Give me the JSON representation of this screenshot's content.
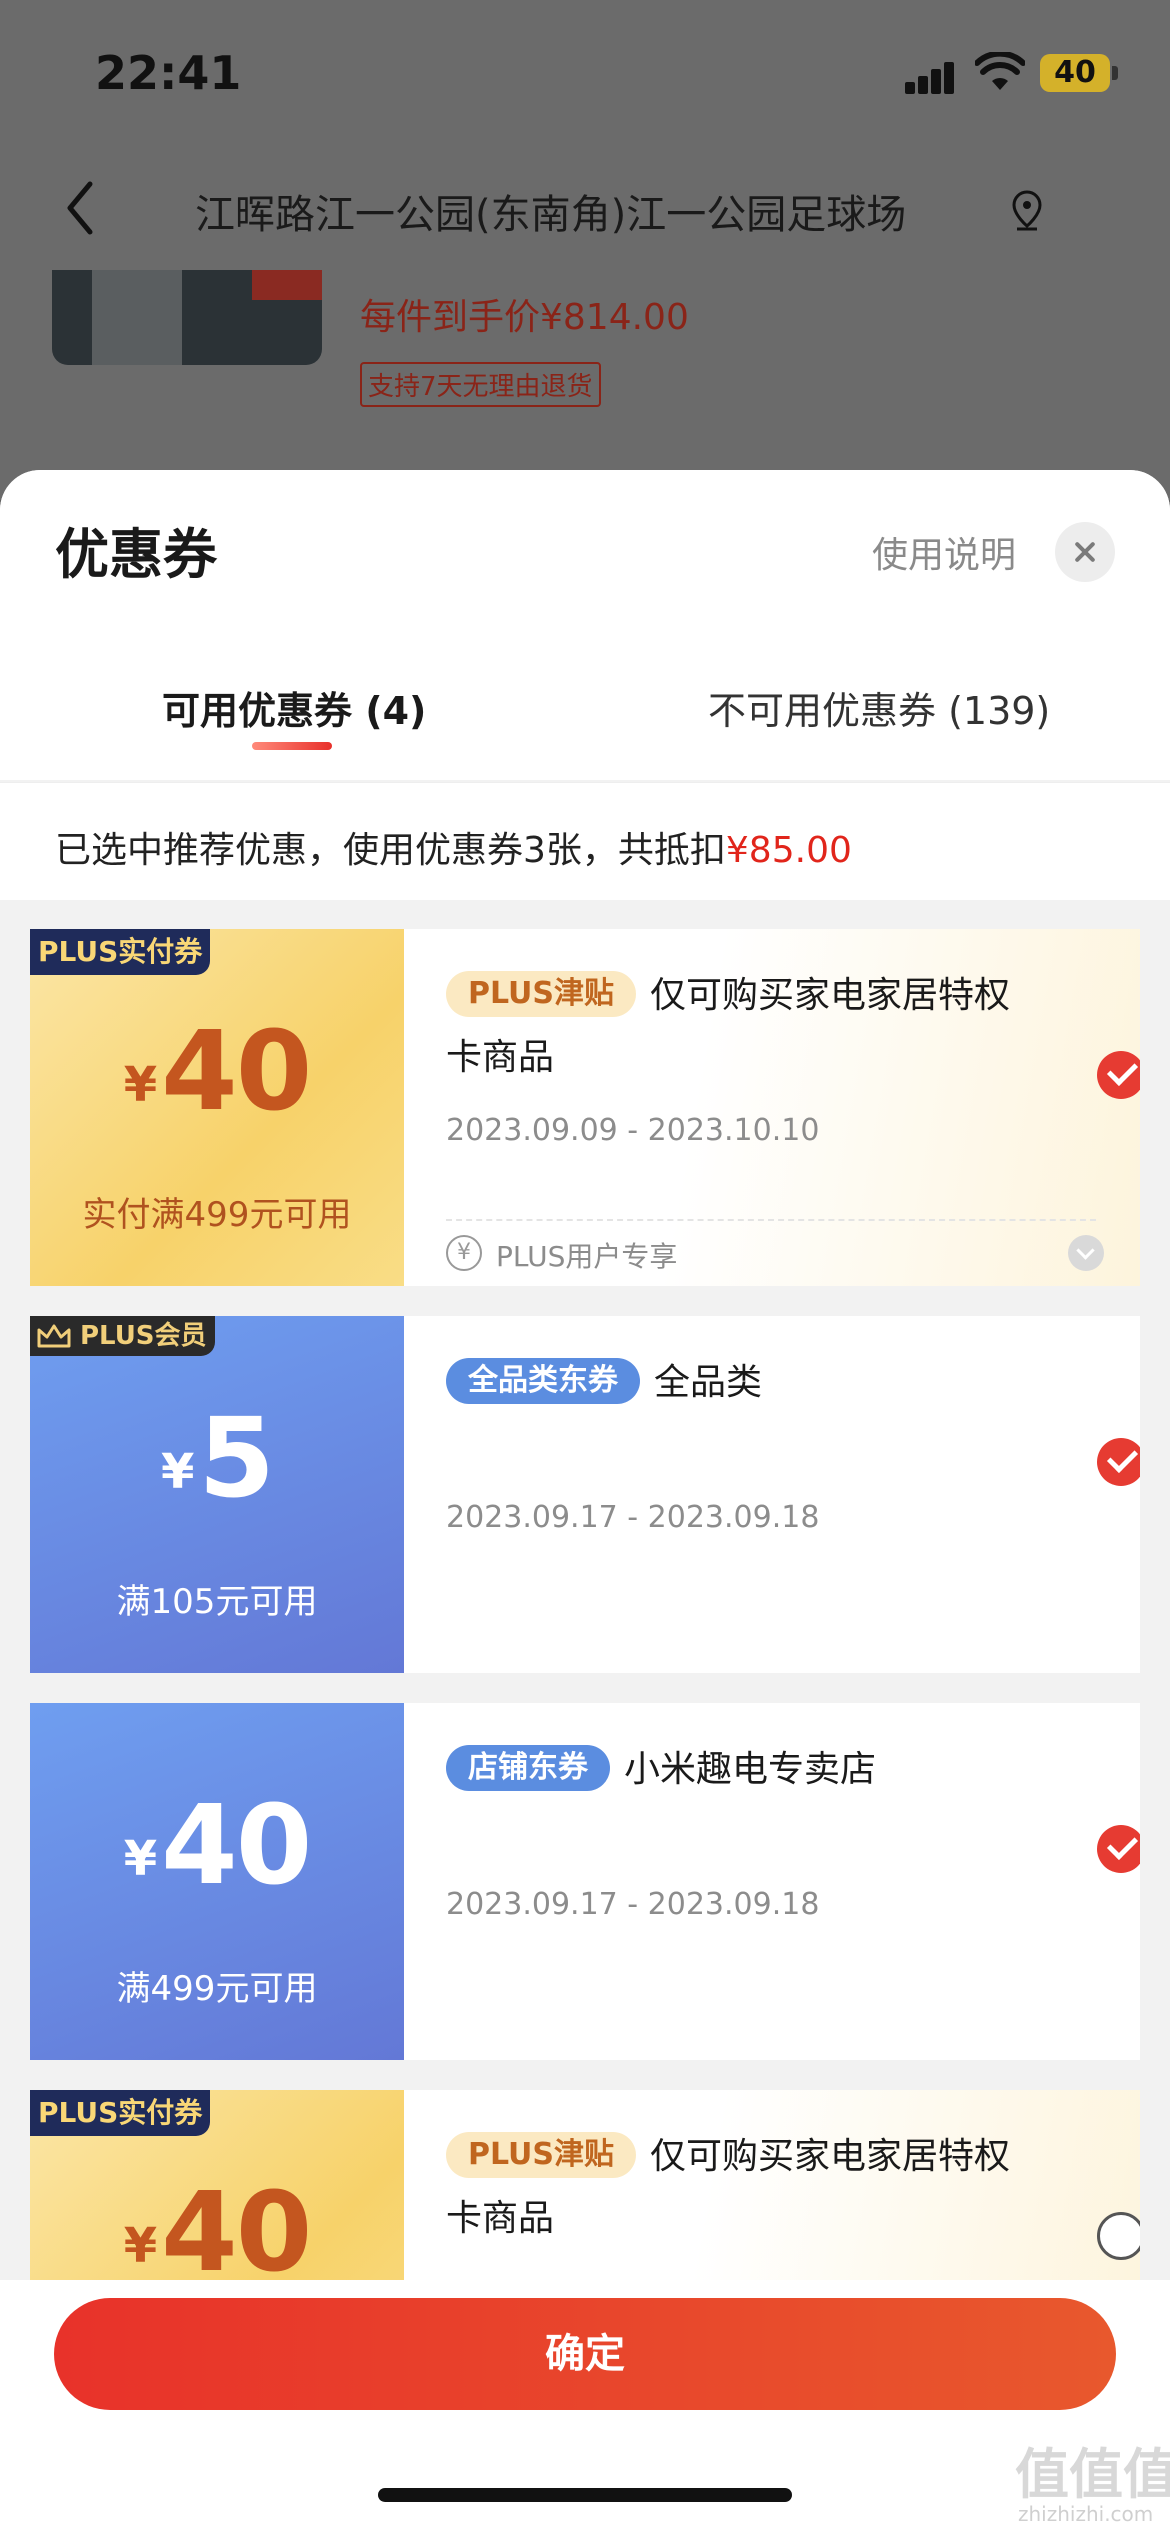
{
  "status_bar": {
    "time": "22:41",
    "battery": "40"
  },
  "nav": {
    "title": "江晖路江一公园(东南角)江一公园足球场"
  },
  "product": {
    "price_text": "每件到手价¥814.00",
    "return_tag": "支持7天无理由退货"
  },
  "sheet": {
    "title": "优惠券",
    "help_link": "使用说明",
    "tabs": [
      {
        "label": "可用优惠券 (4)",
        "active": true
      },
      {
        "label": "不可用优惠券 (139)",
        "active": false
      }
    ],
    "summary": {
      "text": "已选中推荐优惠，使用优惠券3张，共抵扣",
      "amount": "¥85.00"
    }
  },
  "coupons": [
    {
      "badge": "PLUS实付券",
      "currency": "¥",
      "amount": "40",
      "condition": "实付满499元可用",
      "tag": "PLUS津贴",
      "desc": "仅可购买家电家居特权卡商品",
      "date": "2023.09.09 - 2023.10.10",
      "footer": "PLUS用户专享",
      "selected": true
    },
    {
      "badge": "PLUS会员",
      "currency": "¥",
      "amount": "5",
      "condition": "满105元可用",
      "tag": "全品类东券",
      "desc": "全品类",
      "date": "2023.09.17 - 2023.09.18",
      "selected": true
    },
    {
      "currency": "¥",
      "amount": "40",
      "condition": "满499元可用",
      "tag": "店铺东券",
      "desc": "小米趣电专卖店",
      "date": "2023.09.17 - 2023.09.18",
      "selected": true
    },
    {
      "badge": "PLUS实付券",
      "currency": "¥",
      "amount": "40",
      "tag": "PLUS津贴",
      "desc": "仅可购买家电家居特权卡商品",
      "selected": false
    }
  ],
  "confirm_label": "确定",
  "watermark": {
    "main": "值值值",
    "sub": "zhizhizhi.com"
  },
  "colors": {
    "accent": "#e1251b",
    "plus_gold": "#f7d26a",
    "coupon_blue": "#6378d6"
  }
}
